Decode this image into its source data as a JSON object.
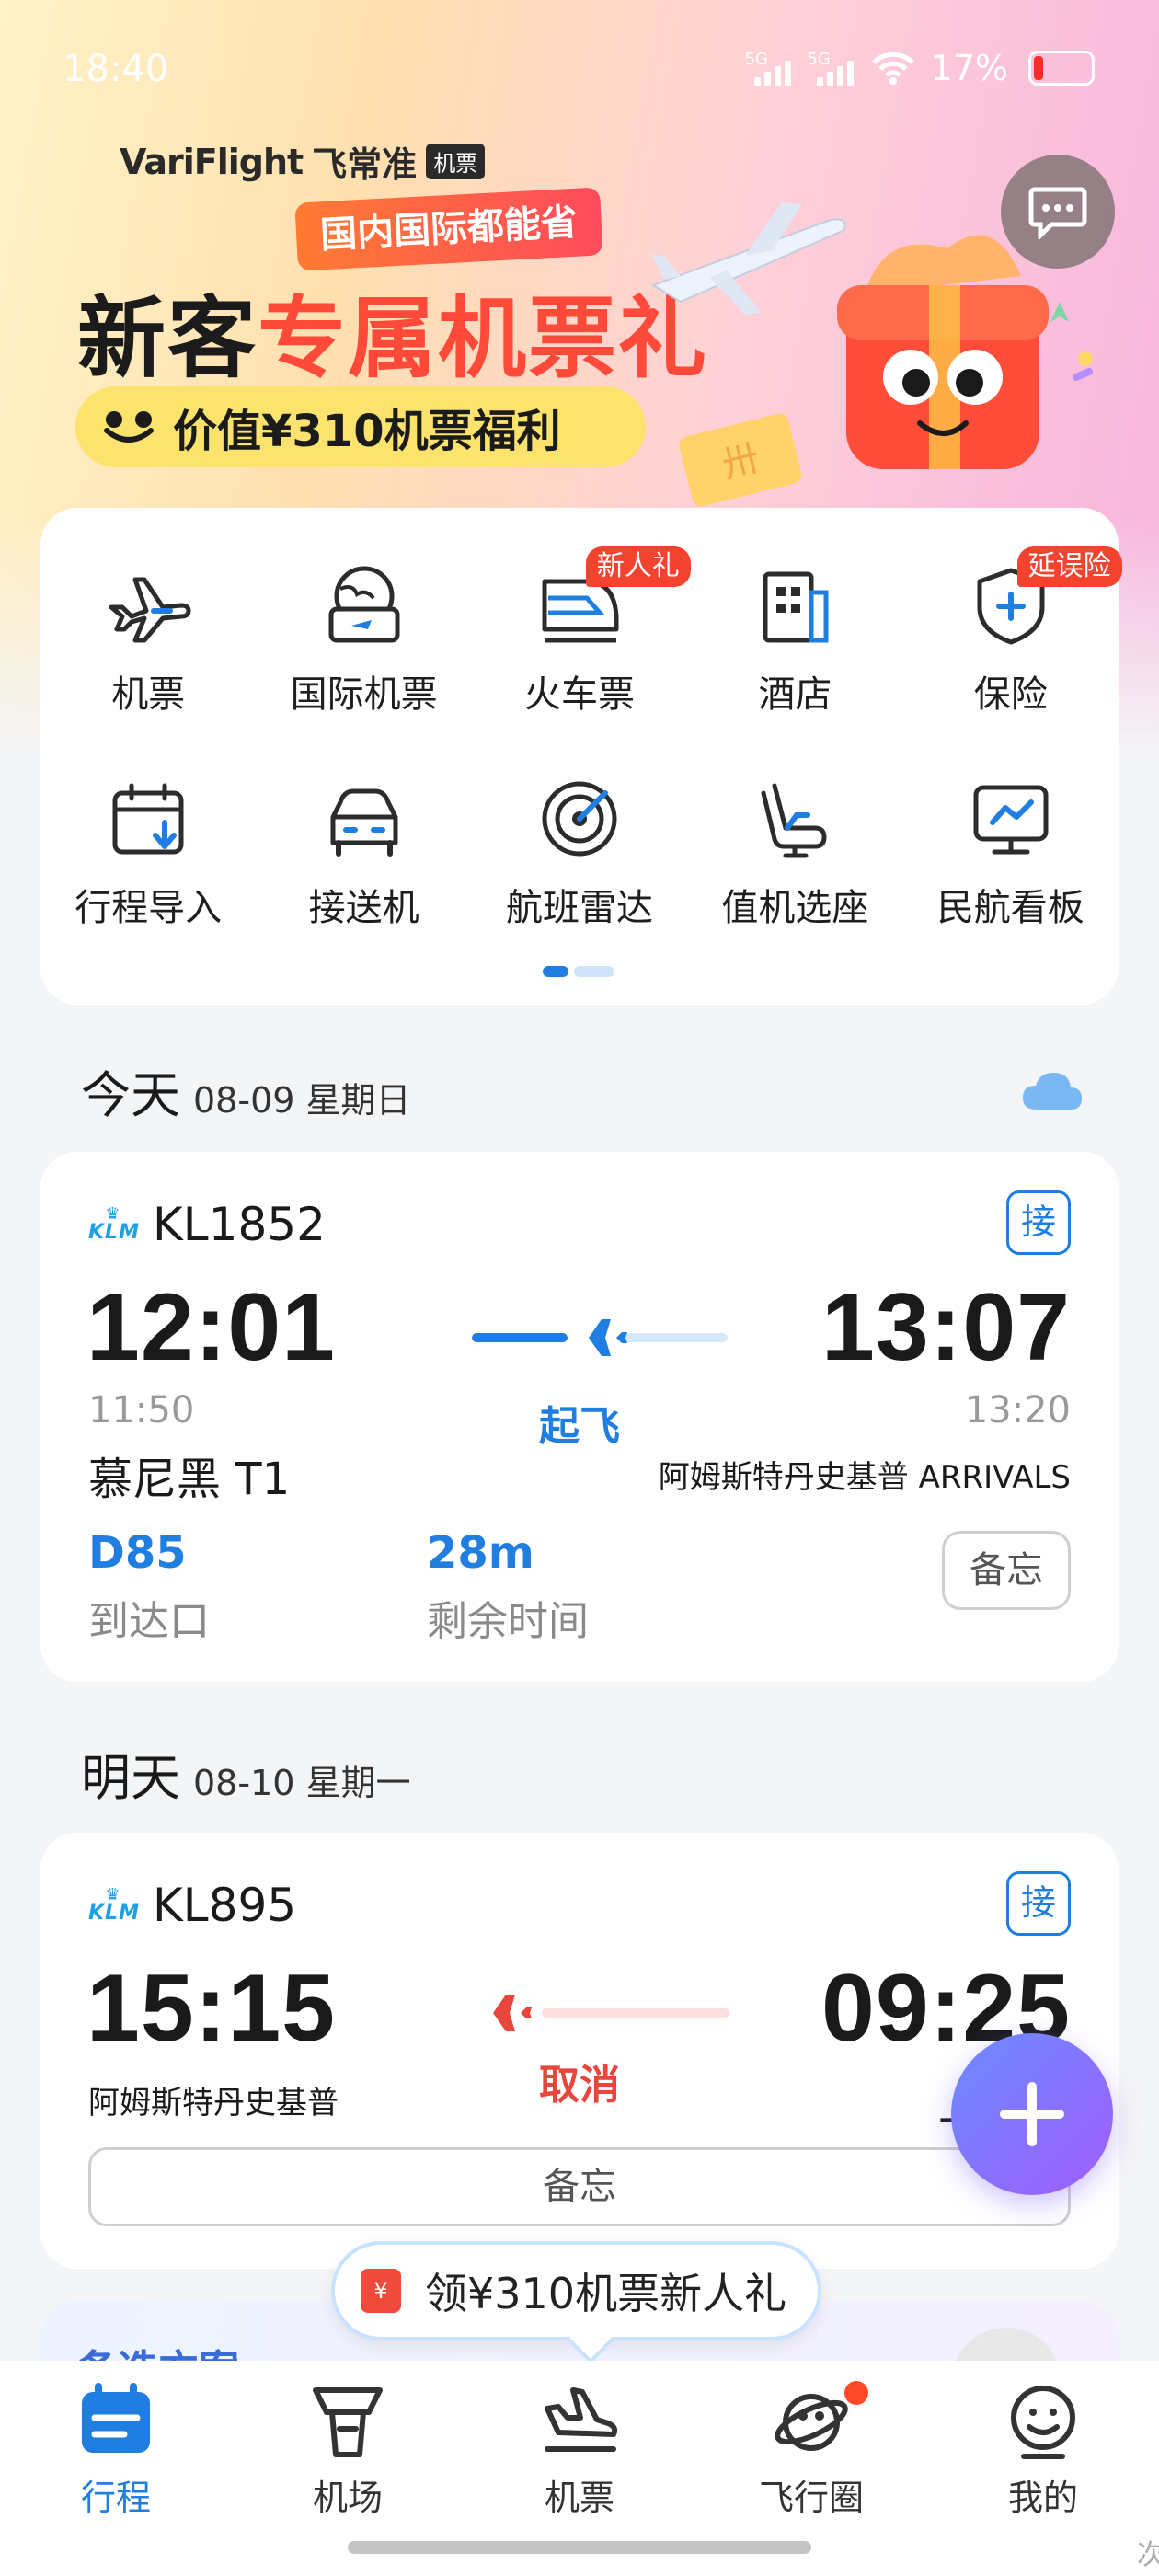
{
  "status_bar": {
    "time": "18:40",
    "network1": "5G",
    "network2": "5G",
    "battery_text": "17%"
  },
  "brand": {
    "name_en": "VariFlight",
    "name_cn": "飞常准",
    "tag": "机票"
  },
  "promo": {
    "tag": "国内国际都能省",
    "title_part1": "新客",
    "title_part2": "专属机票礼",
    "strip_text": "价值¥310机票福利",
    "ticket_glyph": "卅"
  },
  "services": {
    "items": [
      {
        "label": "机票",
        "icon": "plane-icon",
        "badge": ""
      },
      {
        "label": "国际机票",
        "icon": "globe-ticket-icon",
        "badge": ""
      },
      {
        "label": "火车票",
        "icon": "train-icon",
        "badge": "新人礼"
      },
      {
        "label": "酒店",
        "icon": "hotel-icon",
        "badge": ""
      },
      {
        "label": "保险",
        "icon": "shield-plus-icon",
        "badge": "延误险"
      },
      {
        "label": "行程导入",
        "icon": "calendar-import-icon",
        "badge": ""
      },
      {
        "label": "接送机",
        "icon": "car-icon",
        "badge": ""
      },
      {
        "label": "航班雷达",
        "icon": "radar-icon",
        "badge": ""
      },
      {
        "label": "值机选座",
        "icon": "seat-icon",
        "badge": ""
      },
      {
        "label": "民航看板",
        "icon": "monitor-chart-icon",
        "badge": ""
      }
    ]
  },
  "today": {
    "title": "今天",
    "date": "08-09 星期日",
    "weather": "cloud-icon",
    "flight": {
      "airline_logo": "KLM",
      "number": "KL1852",
      "pickup_label": "接",
      "dep_time": "12:01",
      "dep_sched": "11:50",
      "dep_place": "慕尼黑 T1",
      "arr_time": "13:07",
      "arr_sched": "13:20",
      "arr_place": "阿姆斯特丹史基普 ARRIVALS",
      "status": "起飞",
      "status_color": "#1f7ee0",
      "gate_value": "D85",
      "gate_label": "到达口",
      "remaining_value": "28m",
      "remaining_label": "剩余时间",
      "memo_label": "备忘"
    }
  },
  "tomorrow": {
    "title": "明天",
    "date": "08-10 星期一",
    "flight": {
      "airline_logo": "KLM",
      "number": "KL895",
      "pickup_label": "接",
      "dep_time": "15:15",
      "dep_place": "阿姆斯特丹史基普",
      "arr_time": "09:25",
      "arr_place": "上海浦",
      "status": "取消",
      "status_color": "#e8453c",
      "memo_label": "备忘"
    }
  },
  "peek": {
    "title": "备选方案"
  },
  "gift_pill": {
    "text": "领¥310机票新人礼",
    "icon": "red-envelope-icon"
  },
  "tabs": [
    {
      "label": "行程",
      "icon": "itinerary-icon",
      "active": true
    },
    {
      "label": "机场",
      "icon": "tower-icon",
      "active": false
    },
    {
      "label": "机票",
      "icon": "plane-land-icon",
      "active": false
    },
    {
      "label": "飞行圈",
      "icon": "planet-icon",
      "active": false
    },
    {
      "label": "我的",
      "icon": "smile-user-icon",
      "active": false
    }
  ],
  "corner_text": "次",
  "colors": {
    "accent": "#1f7ee0",
    "danger": "#e8453c",
    "badge": "#f2432f"
  }
}
